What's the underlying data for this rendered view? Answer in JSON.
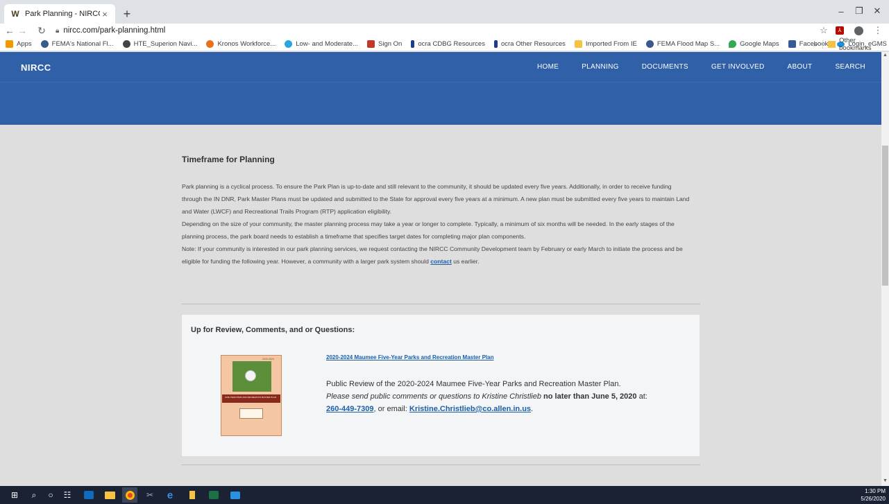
{
  "browser": {
    "tab_title": "Park Planning - NIRCC",
    "tab_favicon": "W",
    "url": "nircc.com/park-planning.html",
    "bookmarks": [
      {
        "label": "Apps",
        "color": "#f29900"
      },
      {
        "label": "FEMA's National Fl...",
        "color": "#3b5a8c"
      },
      {
        "label": "HTE_Superion Navi...",
        "color": "#444444"
      },
      {
        "label": "Kronos Workforce...",
        "color": "#e8711a"
      },
      {
        "label": "Low- and Moderate...",
        "color": "#2aa6df"
      },
      {
        "label": "Sign On",
        "color": "#c0392b"
      },
      {
        "label": "ocra CDBG Resources",
        "color": "#1f3b8c"
      },
      {
        "label": "ocra Other Resources",
        "color": "#1f3b8c"
      },
      {
        "label": "Imported From IE",
        "color": "#f6c244"
      },
      {
        "label": "FEMA Flood Map S...",
        "color": "#3b5a8c"
      },
      {
        "label": "Google Maps",
        "color": "#34a853"
      },
      {
        "label": "Facebook",
        "color": "#3b5998"
      },
      {
        "label": "Login_eGMS",
        "color": "#1e90d8"
      }
    ],
    "overflow_label": "»",
    "other_bookmarks": "Other bookmarks"
  },
  "site": {
    "logo": "NIRCC",
    "nav": [
      "HOME",
      "PLANNING",
      "DOCUMENTS",
      "GET INVOLVED",
      "ABOUT",
      "SEARCH"
    ],
    "header_color": "#2f60a8"
  },
  "content": {
    "section_title": "Timeframe for Planning",
    "para1_line1": "Park planning is a cyclical process. To ensure the Park Plan is up-to-date and still relevant to the community, it should be updated every five years. Additionally, in order to receive funding",
    "para1_line2": "through the IN DNR, Park Master Plans must be updated and submitted to the State for approval every five years at a minimum. A new plan must be submitted every five years to maintain Land",
    "para1_line3": "and Water (LWCF) and Recreational Trails Program (RTP) application eligibility.",
    "para2_line1": "Depending on the size of your community, the master planning process may take a year or longer to complete. Typically, a minimum of six months will be needed. In the early stages of the",
    "para2_line2": "planning process, the park board needs to establish a timeframe that specifies target dates for completing major plan components.",
    "para3_line1": "Note: If your community is interested in our park planning services, we request contacting the NIRCC Community Development team by February or early March to initiate the process and be",
    "para3_line2_before": "eligible for funding the following year. However, a community with a larger park system should ",
    "para3_link": "contact",
    "para3_line2_after": " us earlier."
  },
  "review": {
    "heading": "Up for Review, Comments, and or Questions:",
    "doc_link": "2020-2024 Maumee Five-Year Parks and Recreation Master Plan",
    "cover_year": "2020-2024",
    "cover_band": "FIVE-YEAR PARK AND RECREATION MASTER PLAN",
    "desc_line1": "Public Review of the 2020-2024 Maumee Five-Year Parks and Recreation Master Plan.",
    "desc_italic": "Please send public comments or questions to Kristine Christlieb",
    "desc_bold": " no later than June 5, 2020",
    "desc_at": " at:",
    "phone": "260-449-7309",
    "or_email": ", or email: ",
    "email": "Kristine.Christlieb@co.allen.in.us",
    "period": "."
  },
  "taskbar": {
    "time": "1:30 PM",
    "date": "5/26/2020"
  }
}
